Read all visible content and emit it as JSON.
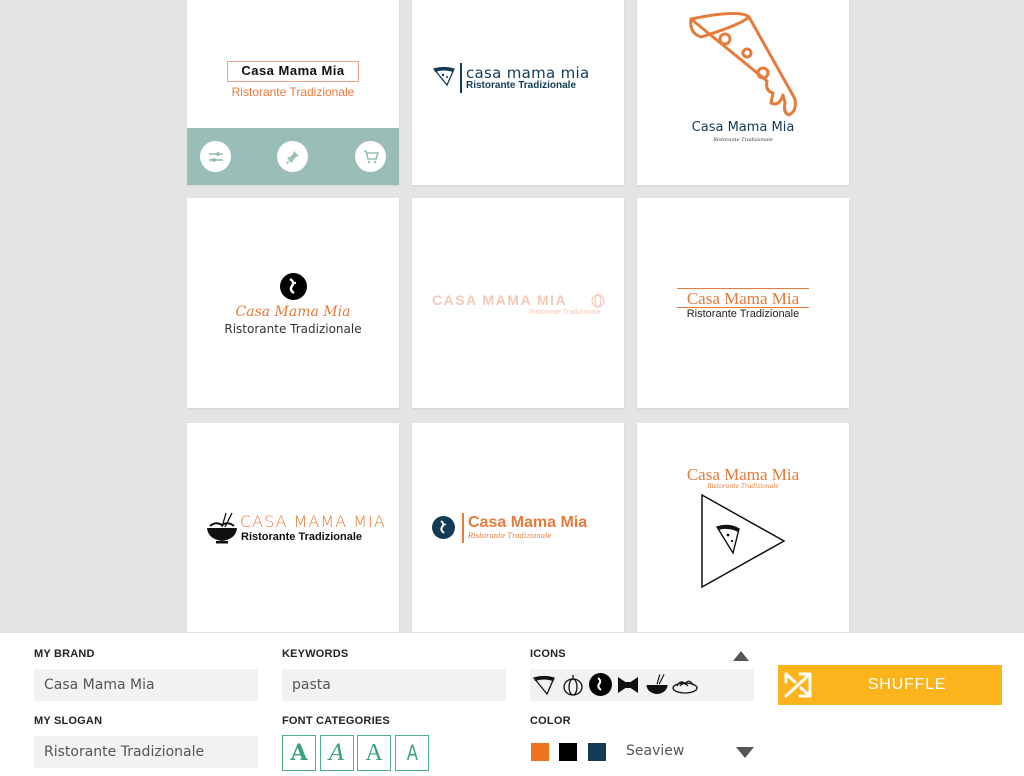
{
  "brand": "Casa Mama Mia",
  "slogan": "Ristorante Tradizionale",
  "cards": {
    "c1": {
      "name": "Casa Mama Mia",
      "slogan": "Ristorante Tradizionale"
    },
    "c2": {
      "name": "casa mama mia",
      "slogan": "Ristorante Tradizionale"
    },
    "c3": {
      "name": "Casa Mama Mia",
      "slogan": "Ristorante Tradizionale"
    },
    "c4": {
      "name": "Casa Mama Mia",
      "slogan": "Ristorante Tradizionale"
    },
    "c5": {
      "name": "CASA MAMA MIA",
      "slogan": "Ristorante Tradizionale"
    },
    "c6": {
      "name": "Casa Mama Mia",
      "slogan": "Ristorante Tradizionale"
    },
    "c7": {
      "name": "CASA MAMA MIA",
      "slogan": "Ristorante Tradizionale"
    },
    "c8": {
      "name": "Casa Mama Mia",
      "slogan": "Ristorante Tradizionale"
    },
    "c9": {
      "name": "Casa Mama Mia",
      "slogan": "Ristorante Tradizionale"
    }
  },
  "card_actions": [
    "adjust-icon",
    "pin-icon",
    "cart-icon"
  ],
  "panel": {
    "my_brand_label": "MY BRAND",
    "my_brand_value": "Casa Mama Mia",
    "my_slogan_label": "MY SLOGAN",
    "my_slogan_value": "Ristorante Tradizionale",
    "keywords_label": "KEYWORDS",
    "keywords_value": "pasta",
    "font_categories_label": "FONT CATEGORIES",
    "font_glyph": "A",
    "icons_label": "ICONS",
    "icons": [
      "pizza-slice-icon",
      "onion-icon",
      "pasta-badge-icon",
      "farfalle-icon",
      "noodle-bowl-icon",
      "spaghetti-plate-icon"
    ],
    "color_label": "COLOR",
    "colors": [
      "#f07322",
      "#000000",
      "#143b55"
    ],
    "color_scheme": "Seaview",
    "shuffle_label": "SHUFFLE"
  },
  "theme": {
    "accent": "#e67b3b",
    "navy": "#143b55",
    "action_bar": "#9abdb8",
    "shuffle_bg": "#fbb41b",
    "font_category": "#3aa07a"
  }
}
